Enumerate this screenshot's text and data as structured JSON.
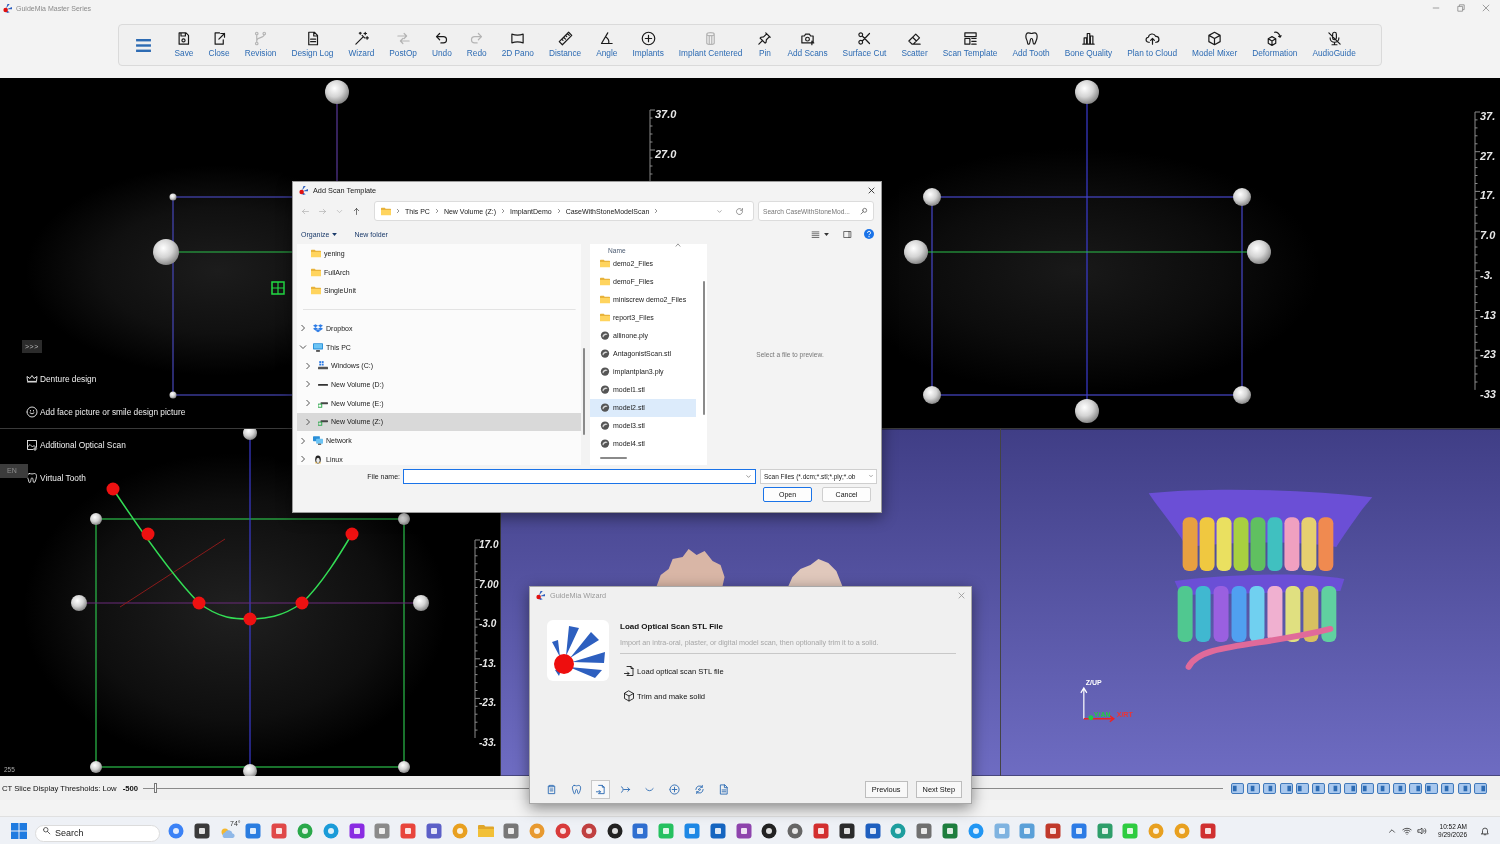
{
  "app": {
    "title": "GuideMia Master Series"
  },
  "toolbar": {
    "items": [
      {
        "label": "Save",
        "disabled": false
      },
      {
        "label": "Close",
        "disabled": false
      },
      {
        "label": "Revision",
        "disabled": true
      },
      {
        "label": "Design Log",
        "disabled": false
      },
      {
        "label": "Wizard",
        "disabled": false
      },
      {
        "label": "PostOp",
        "disabled": true
      },
      {
        "label": "Undo",
        "disabled": false
      },
      {
        "label": "Redo",
        "disabled": true
      },
      {
        "label": "2D Pano",
        "disabled": false
      },
      {
        "label": "Distance",
        "disabled": false
      },
      {
        "label": "Angle",
        "disabled": false
      },
      {
        "label": "Implants",
        "disabled": false
      },
      {
        "label": "Implant Centered",
        "disabled": true
      },
      {
        "label": "Pin",
        "disabled": false
      },
      {
        "label": "Add Scans",
        "disabled": false
      },
      {
        "label": "Surface Cut",
        "disabled": false
      },
      {
        "label": "Scatter",
        "disabled": false
      },
      {
        "label": "Scan Template",
        "disabled": false
      },
      {
        "label": "Add Tooth",
        "disabled": false
      },
      {
        "label": "Bone Quality",
        "disabled": false
      },
      {
        "label": "Plan to Cloud",
        "disabled": false
      },
      {
        "label": "Model Mixer",
        "disabled": false
      },
      {
        "label": "Deformation",
        "disabled": false
      },
      {
        "label": "AudioGuide",
        "disabled": false
      }
    ]
  },
  "viewports": {
    "top_left": {
      "ruler": [
        "37.0",
        "27.0"
      ]
    },
    "top_right": {
      "ruler": [
        "37.",
        "27.",
        "17.",
        "7.0",
        "-3.",
        "-13",
        "-23",
        "-33"
      ]
    },
    "bottom_left": {
      "ruler": [
        "17.0",
        "7.00",
        "-3.0",
        "-13.",
        "-23.",
        "-33."
      ],
      "pixel_value": "255"
    },
    "bottom_right": {
      "axis_labels": [
        "Z/UP",
        "Y/AN",
        "X/RT"
      ]
    }
  },
  "side_menu": {
    "toggle": ">>>",
    "items": [
      "Denture design",
      "Add face picture or smile design picture",
      "Additional Optical Scan",
      "Virtual Tooth"
    ],
    "language_badge": "EN"
  },
  "status_bar": {
    "label": "CT Slice Display Thresholds: Low",
    "value": "-500",
    "threshold_slider": {
      "level": 0.01
    }
  },
  "file_dialog": {
    "title": "Add Scan Template",
    "active": true,
    "nav_buttons": [
      {
        "disabled": true
      },
      {
        "disabled": true
      },
      {
        "disabled": true
      },
      {
        "disabled": false
      }
    ],
    "breadcrumb": [
      "This PC",
      "New Volume (Z:)",
      "ImplantDemo",
      "CaseWithStoneModelScan"
    ],
    "search": {
      "placeholder": "Search CaseWithStoneMod..."
    },
    "commands": {
      "organize": "Organize",
      "new_folder": "New folder"
    },
    "quick_access": [
      "yening",
      "FullArch",
      "SingleUnit"
    ],
    "tree": [
      {
        "label": "Dropbox",
        "kind": "cloud",
        "expanded": false,
        "selected": false
      },
      {
        "label": "This PC",
        "kind": "computer",
        "expanded": true,
        "selected": false,
        "children": [
          {
            "label": "Windows (C:)",
            "kind": "system",
            "expanded": false,
            "selected": false
          },
          {
            "label": "New Volume (D:)",
            "kind": "drive",
            "expanded": false,
            "selected": false
          },
          {
            "label": "New Volume (E:)",
            "kind": "mapped",
            "expanded": false,
            "selected": false
          },
          {
            "label": "New Volume (Z:)",
            "kind": "mapped",
            "expanded": false,
            "selected": true
          }
        ]
      },
      {
        "label": "Network",
        "kind": "network",
        "expanded": false,
        "selected": false
      },
      {
        "label": "Linux",
        "kind": "linux",
        "expanded": false,
        "selected": false
      }
    ],
    "files": {
      "column": "Name",
      "items": [
        {
          "label": "demo2_Files",
          "kind": "folder",
          "selected": false
        },
        {
          "label": "demoF_Files",
          "kind": "folder",
          "selected": false
        },
        {
          "label": "miniscrew demo2_Files",
          "kind": "folder",
          "selected": false
        },
        {
          "label": "report3_Files",
          "kind": "folder",
          "selected": false
        },
        {
          "label": "allinone.ply",
          "kind": "mesh",
          "selected": false
        },
        {
          "label": "AntagonistScan.stl",
          "kind": "mesh",
          "selected": false
        },
        {
          "label": "implantplan3.ply",
          "kind": "mesh",
          "selected": false
        },
        {
          "label": "model1.stl",
          "kind": "mesh",
          "selected": false
        },
        {
          "label": "model2.stl",
          "kind": "mesh",
          "selected": true
        },
        {
          "label": "model3.stl",
          "kind": "mesh",
          "selected": false
        },
        {
          "label": "model4.stl",
          "kind": "mesh",
          "selected": false
        }
      ]
    },
    "preview_text": "Select a file to preview.",
    "file_name": {
      "label": "File name:",
      "focused": true
    },
    "file_type": "Scan Files (*.dcm;*.stl;*.ply;*.ob",
    "buttons": [
      {
        "label": "Open",
        "default": true
      },
      {
        "label": "Cancel",
        "default": false
      }
    ]
  },
  "wizard": {
    "title": "GuideMia Wizard",
    "active": false,
    "heading": "Load Optical Scan STL File",
    "description": "Import an intra-oral, plaster, or digital model scan, then optionally trim it to a solid.",
    "actions": [
      "Load optical scan STL file",
      "Trim and make solid"
    ],
    "steps": [
      {
        "selected": false
      },
      {
        "selected": false
      },
      {
        "selected": true
      },
      {
        "selected": false
      },
      {
        "selected": false
      },
      {
        "selected": false
      },
      {
        "selected": false
      },
      {
        "selected": false
      }
    ],
    "buttons": [
      "Previous",
      "Next Step"
    ]
  },
  "taskbar": {
    "search": {
      "placeholder": "Search"
    },
    "weather": "74°",
    "time": "10:52 AM",
    "date": "9/29/2026"
  }
}
